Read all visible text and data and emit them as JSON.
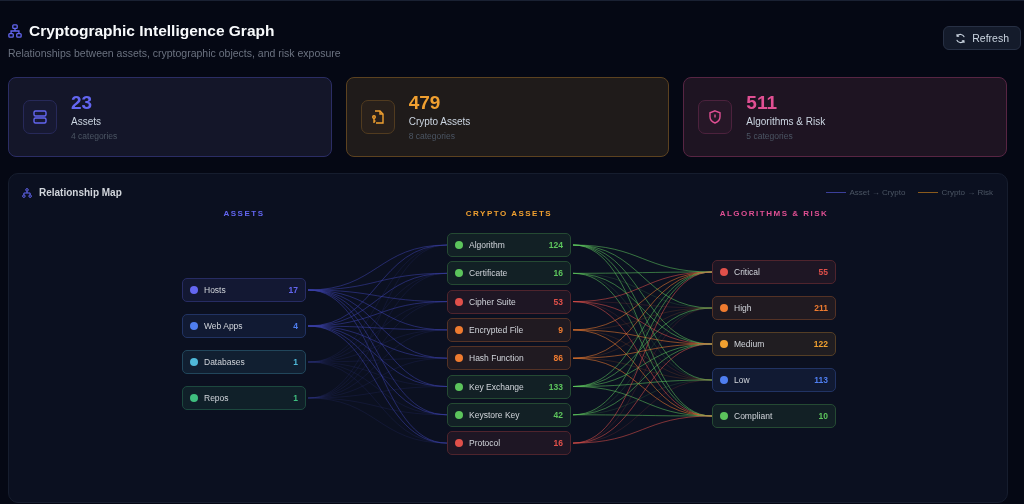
{
  "header": {
    "title": "Cryptographic Intelligence Graph",
    "subtitle": "Relationships between assets, cryptographic objects, and risk exposure",
    "refresh_label": "Refresh"
  },
  "stats": [
    {
      "kind": "server",
      "value": "23",
      "label": "Assets",
      "sublabel": "4 categories",
      "color": "#6366f1"
    },
    {
      "kind": "file",
      "value": "479",
      "label": "Crypto Assets",
      "sublabel": "8 categories",
      "color": "#f0a030"
    },
    {
      "kind": "shield",
      "value": "511",
      "label": "Algorithms & Risk",
      "sublabel": "5 categories",
      "color": "#e04f93"
    }
  ],
  "map": {
    "title": "Relationship Map",
    "legend": [
      {
        "label": "Asset → Crypto",
        "color": "#3b3f9a"
      },
      {
        "label": "Crypto → Risk",
        "color": "#8a5a1c"
      }
    ],
    "columns": [
      {
        "title": "ASSETS",
        "color": "#6366f1",
        "nodes": [
          {
            "label": "Hosts",
            "count": "17",
            "color": "#6366f1"
          },
          {
            "label": "Web Apps",
            "count": "4",
            "color": "#4f7ef0"
          },
          {
            "label": "Databases",
            "count": "1",
            "color": "#4fb8d8"
          },
          {
            "label": "Repos",
            "count": "1",
            "color": "#3fbf7f"
          }
        ]
      },
      {
        "title": "CRYPTO ASSETS",
        "color": "#f0a030",
        "nodes": [
          {
            "label": "Algorithm",
            "count": "124",
            "color": "#5cc45c"
          },
          {
            "label": "Certificate",
            "count": "16",
            "color": "#5cc45c"
          },
          {
            "label": "Cipher Suite",
            "count": "53",
            "color": "#e0504a"
          },
          {
            "label": "Encrypted File",
            "count": "9",
            "color": "#ef7b2f"
          },
          {
            "label": "Hash Function",
            "count": "86",
            "color": "#ef7b2f"
          },
          {
            "label": "Key Exchange",
            "count": "133",
            "color": "#5cc45c"
          },
          {
            "label": "Keystore Key",
            "count": "42",
            "color": "#5cc45c"
          },
          {
            "label": "Protocol",
            "count": "16",
            "color": "#e0504a"
          }
        ]
      },
      {
        "title": "ALGORITHMS & RISK",
        "color": "#e04f93",
        "nodes": [
          {
            "label": "Critical",
            "count": "55",
            "color": "#e0504a"
          },
          {
            "label": "High",
            "count": "211",
            "color": "#ef7b2f"
          },
          {
            "label": "Medium",
            "count": "122",
            "color": "#f0a030"
          },
          {
            "label": "Low",
            "count": "113",
            "color": "#4f7ef0"
          },
          {
            "label": "Compliant",
            "count": "10",
            "color": "#5cc45c"
          }
        ]
      }
    ]
  }
}
